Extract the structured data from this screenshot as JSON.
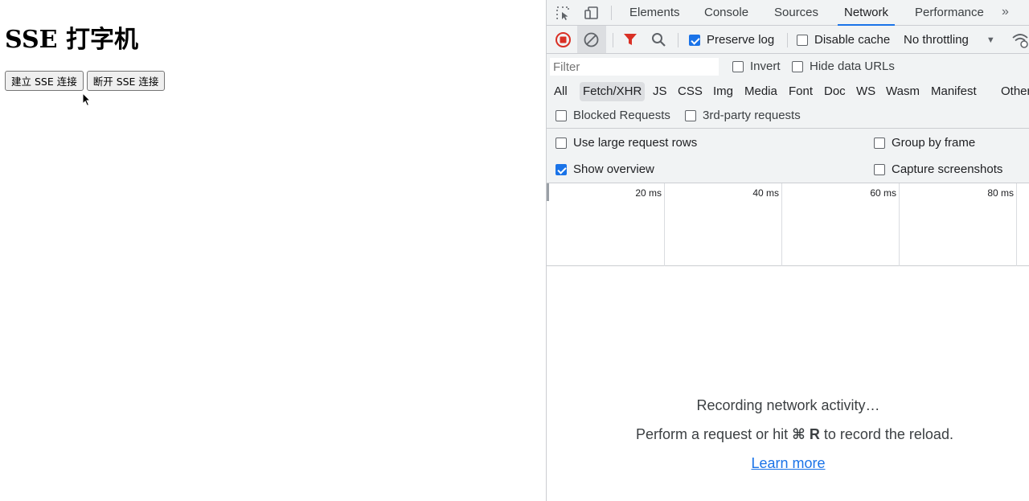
{
  "page": {
    "heading": "SSE 打字机",
    "connect_button": "建立 SSE 连接",
    "disconnect_button": "断开 SSE 连接"
  },
  "devtools": {
    "tabs": [
      "Elements",
      "Console",
      "Sources",
      "Network",
      "Performance"
    ],
    "active_tab": "Network",
    "toolbar": {
      "preserve_log": "Preserve log",
      "preserve_log_checked": true,
      "disable_cache": "Disable cache",
      "disable_cache_checked": false,
      "throttling": "No throttling"
    },
    "filter": {
      "placeholder": "Filter",
      "invert": "Invert",
      "hide_data_urls": "Hide data URLs"
    },
    "types": [
      "All",
      "Fetch/XHR",
      "JS",
      "CSS",
      "Img",
      "Media",
      "Font",
      "Doc",
      "WS",
      "Wasm",
      "Manifest",
      "Other"
    ],
    "active_type": "Fetch/XHR",
    "blocked_requests": "Blocked Requests",
    "third_party": "3rd-party requests",
    "settings": {
      "large_rows": "Use large request rows",
      "group_by_frame": "Group by frame",
      "show_overview": "Show overview",
      "show_overview_checked": true,
      "capture_screenshots": "Capture screenshots"
    },
    "overview_ticks": [
      "20 ms",
      "40 ms",
      "60 ms",
      "80 ms"
    ],
    "empty": {
      "recording": "Recording network activity…",
      "hint_prefix": "Perform a request or hit",
      "hint_key": "⌘ R",
      "hint_suffix": "to record the reload.",
      "learn_more": "Learn more"
    },
    "colors": {
      "accent": "#1a73e8",
      "record_red": "#d93025"
    }
  }
}
